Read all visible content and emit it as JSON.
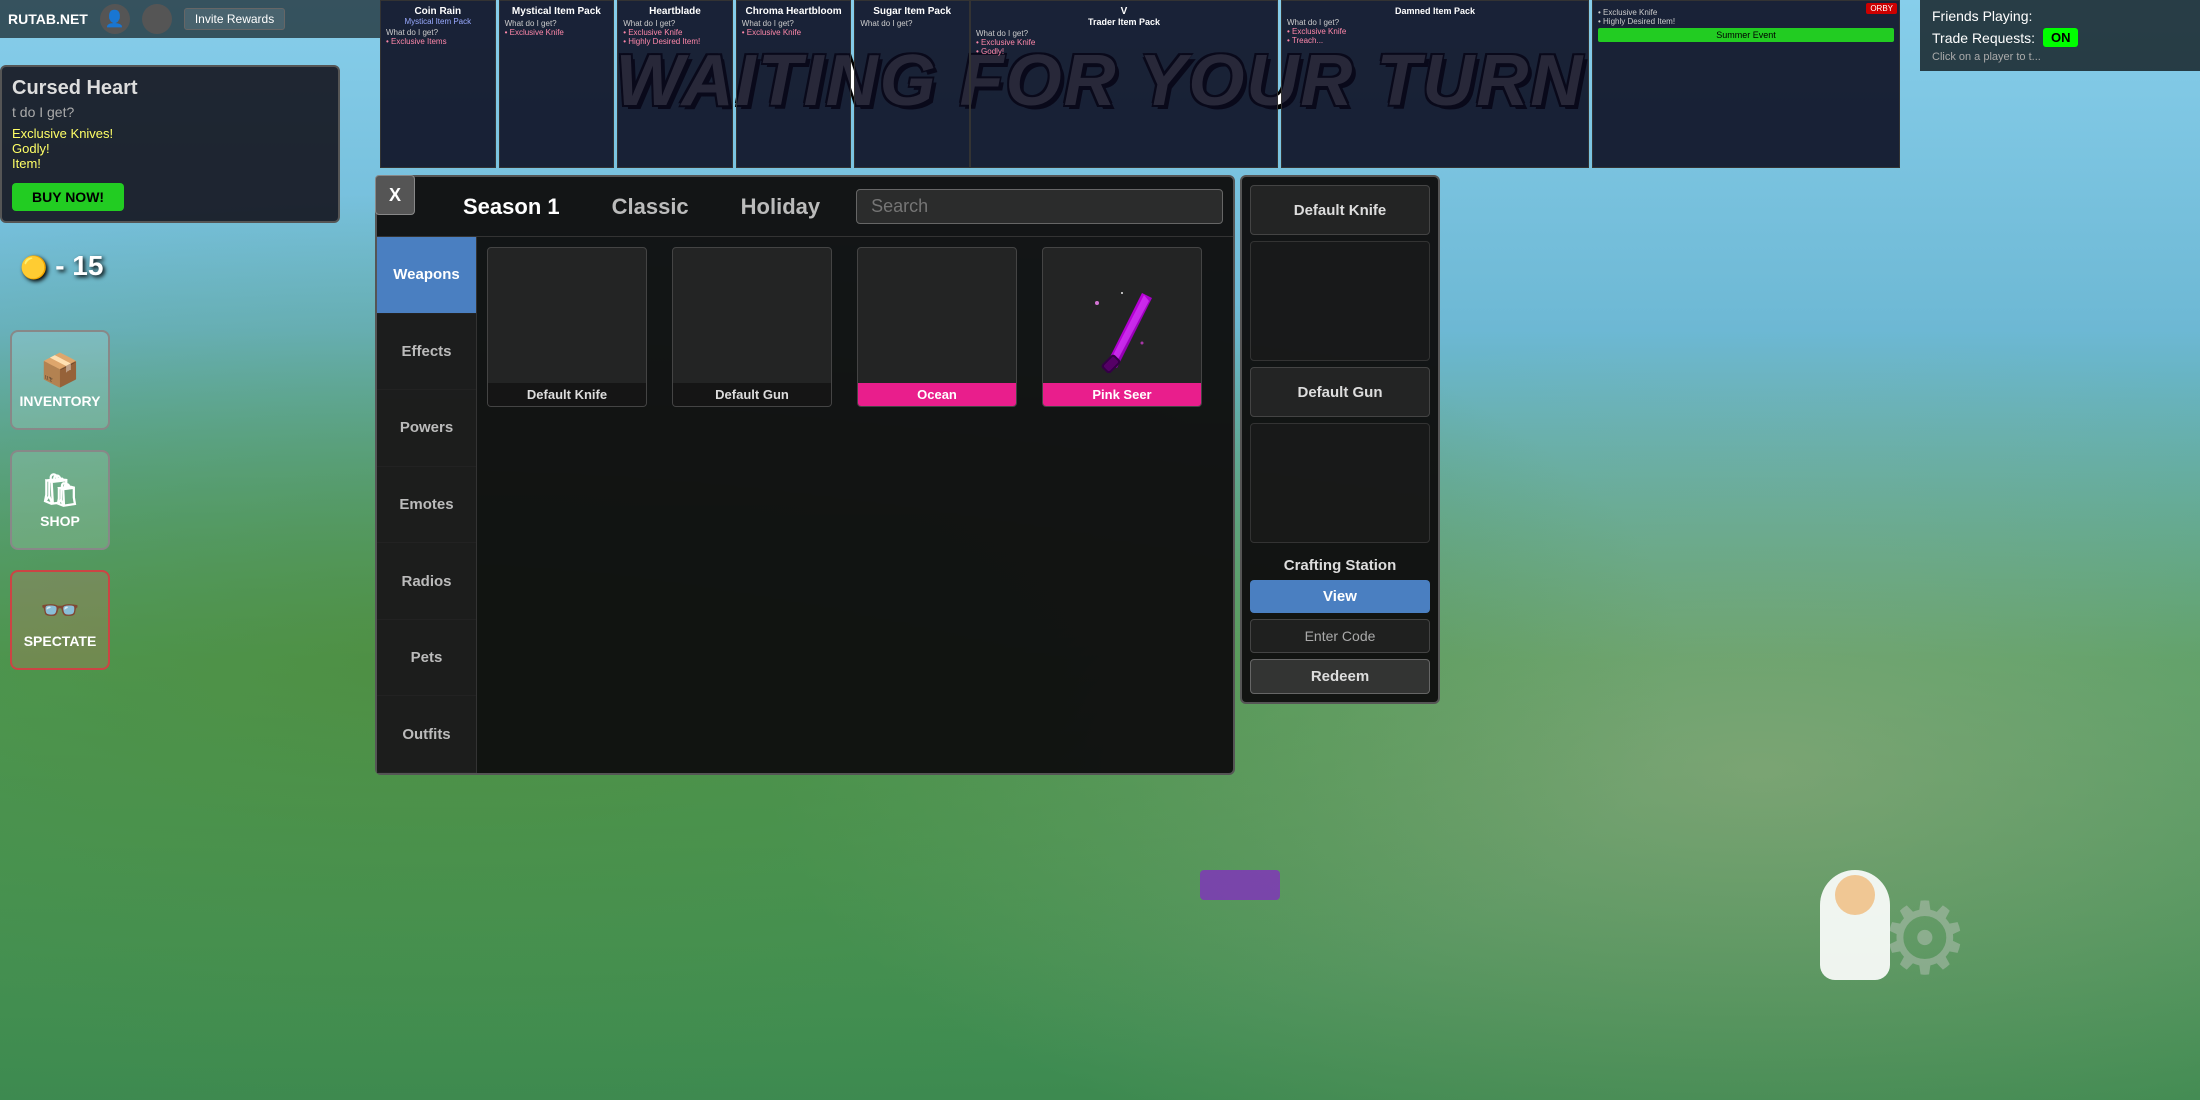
{
  "site": {
    "logo": "RUTAB.NET",
    "invite_rewards": "Invite Rewards"
  },
  "banner": {
    "text": "WAITING FOR YOUR TURN"
  },
  "friends_panel": {
    "title": "Friends Playing:",
    "trade_label": "Trade Requests:",
    "trade_status": "ON",
    "click_hint": "Click on a player to t..."
  },
  "left_hud": {
    "currency": "- 15",
    "nav_items": [
      {
        "id": "inventory",
        "label": "INVENTORY",
        "icon": "📦"
      },
      {
        "id": "shop",
        "label": "SHOP",
        "icon": "🛍"
      },
      {
        "id": "spectate",
        "label": "SPECTATE",
        "icon": "👓"
      }
    ]
  },
  "item_card": {
    "title": "Cursed Heart",
    "question": "t do I get?",
    "content": "Exclusive Knives!\nGodly!\nItem!",
    "buy_label": "BUY NOW!"
  },
  "tabs": [
    {
      "id": "season1",
      "label": "Season 1",
      "active": true
    },
    {
      "id": "classic",
      "label": "Classic"
    },
    {
      "id": "holiday",
      "label": "Holiday"
    }
  ],
  "search": {
    "placeholder": "Search"
  },
  "categories": [
    {
      "id": "weapons",
      "label": "Weapons",
      "active": true
    },
    {
      "id": "effects",
      "label": "Effects"
    },
    {
      "id": "powers",
      "label": "Powers"
    },
    {
      "id": "emotes",
      "label": "Emotes"
    },
    {
      "id": "radios",
      "label": "Radios"
    },
    {
      "id": "pets",
      "label": "Pets"
    },
    {
      "id": "outfits",
      "label": "Outfits"
    }
  ],
  "grid_items": [
    {
      "id": "default-knife",
      "label": "Default Knife",
      "pink": false,
      "has_image": false
    },
    {
      "id": "default-gun",
      "label": "Default Gun",
      "pink": false,
      "has_image": false
    },
    {
      "id": "ocean",
      "label": "Ocean",
      "pink": true,
      "has_image": false
    },
    {
      "id": "pink-seer",
      "label": "Pink Seer",
      "pink": true,
      "has_image": true
    }
  ],
  "right_panel": {
    "equip_slots": [
      {
        "id": "equipped-knife",
        "label": "Default Knife"
      },
      {
        "id": "equipped-gun",
        "label": "Default Gun"
      }
    ],
    "crafting": {
      "title": "Crafting Station",
      "view_label": "View",
      "enter_code_label": "Enter Code",
      "redeem_label": "Redeem"
    }
  },
  "close_btn": "X",
  "promo_cards": [
    {
      "title": "Coin Rain",
      "sub": "Mystical Item Pack",
      "body": "What do I get?",
      "highlight": "• Exclusive Items"
    },
    {
      "title": "Mystical Item Pack",
      "sub": "",
      "body": "What do I get?",
      "highlight": "• Exclusive Knife"
    },
    {
      "title": "Heartblade",
      "sub": "",
      "body": "What do I get?",
      "highlight": "• Exclusive Knife\n• Highly Desired Item!"
    },
    {
      "title": "Chroma Heartbloom",
      "sub": "",
      "body": "What do I get?",
      "highlight": "• Exclusive Knife"
    },
    {
      "title": "Sugar Item Pack",
      "sub": "",
      "body": "What do I get?",
      "highlight": ""
    }
  ]
}
